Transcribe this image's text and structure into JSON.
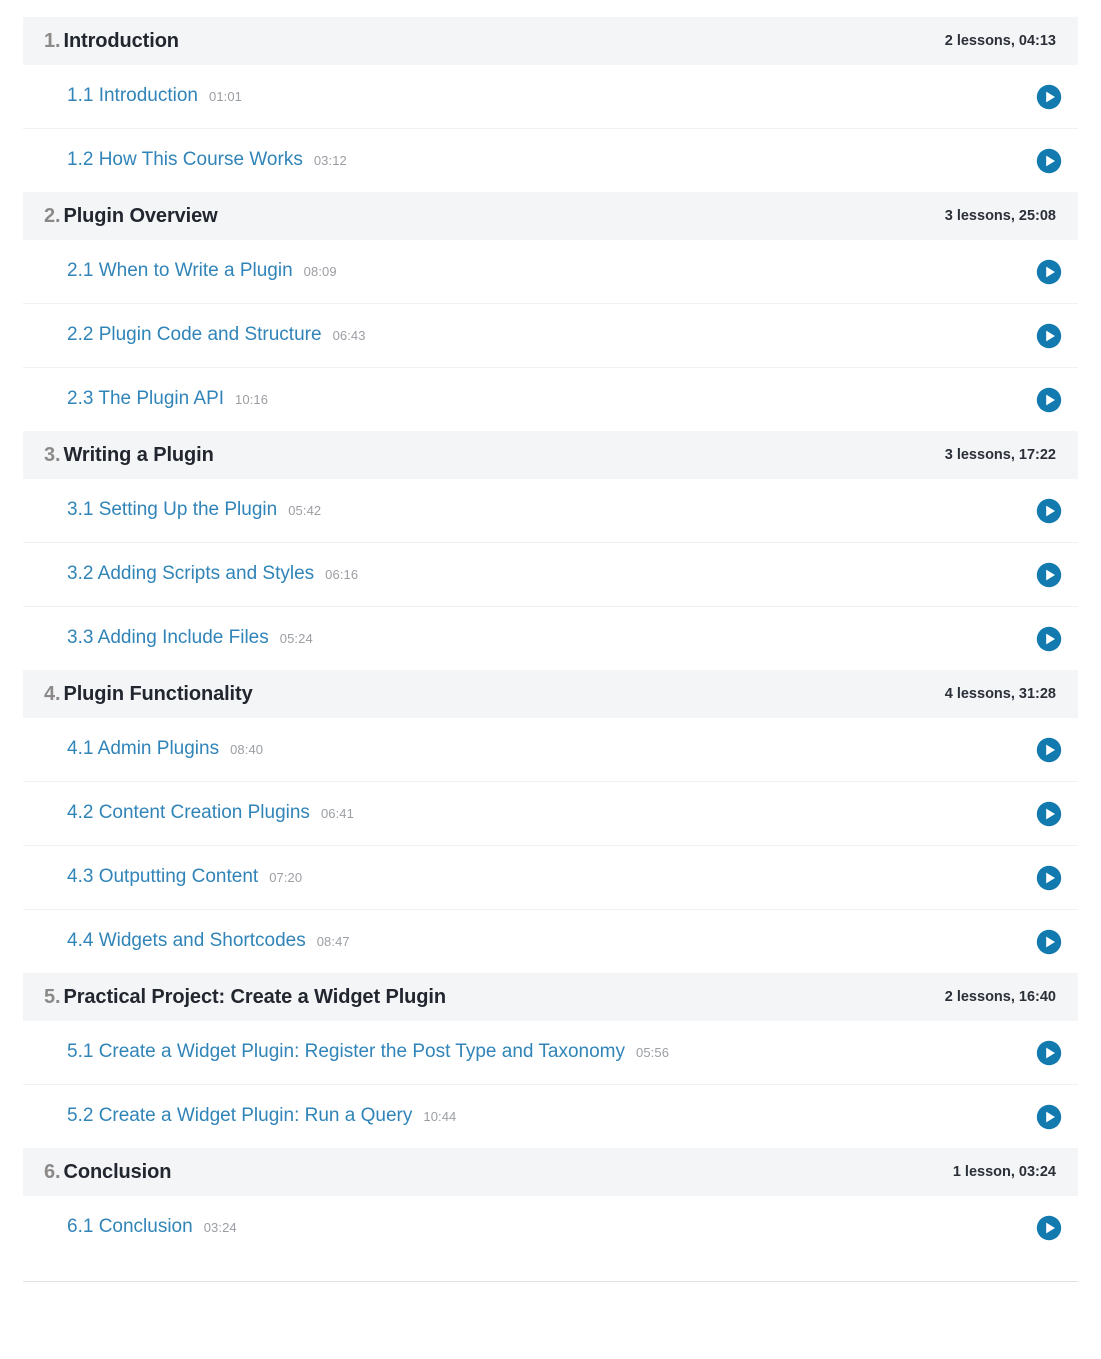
{
  "icons": {
    "play": "play-circle-icon"
  },
  "colors": {
    "link": "#3084b8",
    "header_bg": "#f4f5f7",
    "section_number": "#8b8a88",
    "section_title": "#22262e",
    "duration": "#9b9ea3",
    "play_icon": "#127aae",
    "row_divider": "#f0f1f3",
    "bottom_rule": "#dfe1e5"
  },
  "curriculum": {
    "sections": [
      {
        "number": "1.",
        "title": "Introduction",
        "meta": "2 lessons, 04:13",
        "lessons": [
          {
            "title": "1.1 Introduction",
            "duration": "01:01"
          },
          {
            "title": "1.2 How This Course Works",
            "duration": "03:12"
          }
        ]
      },
      {
        "number": "2.",
        "title": "Plugin Overview",
        "meta": "3 lessons, 25:08",
        "lessons": [
          {
            "title": "2.1 When to Write a Plugin",
            "duration": "08:09"
          },
          {
            "title": "2.2 Plugin Code and Structure",
            "duration": "06:43"
          },
          {
            "title": "2.3 The Plugin API",
            "duration": "10:16"
          }
        ]
      },
      {
        "number": "3.",
        "title": "Writing a Plugin",
        "meta": "3 lessons, 17:22",
        "lessons": [
          {
            "title": "3.1 Setting Up the Plugin",
            "duration": "05:42"
          },
          {
            "title": "3.2 Adding Scripts and Styles",
            "duration": "06:16"
          },
          {
            "title": "3.3 Adding Include Files",
            "duration": "05:24"
          }
        ]
      },
      {
        "number": "4.",
        "title": "Plugin Functionality",
        "meta": "4 lessons, 31:28",
        "lessons": [
          {
            "title": "4.1 Admin Plugins",
            "duration": "08:40"
          },
          {
            "title": "4.2 Content Creation Plugins",
            "duration": "06:41"
          },
          {
            "title": "4.3 Outputting Content",
            "duration": "07:20"
          },
          {
            "title": "4.4 Widgets and Shortcodes",
            "duration": "08:47"
          }
        ]
      },
      {
        "number": "5.",
        "title": "Practical Project: Create a Widget Plugin",
        "meta": "2 lessons, 16:40",
        "lessons": [
          {
            "title": "5.1 Create a Widget Plugin: Register the Post Type and Taxonomy",
            "duration": "05:56"
          },
          {
            "title": "5.2 Create a Widget Plugin: Run a Query",
            "duration": "10:44"
          }
        ]
      },
      {
        "number": "6.",
        "title": "Conclusion",
        "meta": "1 lesson, 03:24",
        "lessons": [
          {
            "title": "6.1 Conclusion",
            "duration": "03:24"
          }
        ]
      }
    ]
  }
}
